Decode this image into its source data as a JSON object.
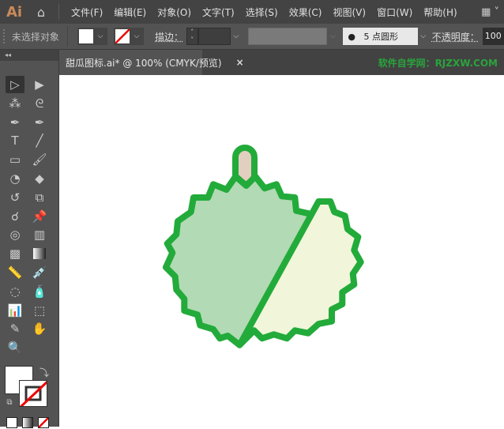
{
  "app": {
    "logo": "Ai",
    "home_icon": "home-icon",
    "workspace_icon": "workspace-switcher-icon"
  },
  "menu": [
    "文件(F)",
    "编辑(E)",
    "对象(O)",
    "文字(T)",
    "选择(S)",
    "效果(C)",
    "视图(V)",
    "窗口(W)",
    "帮助(H)"
  ],
  "control": {
    "selection": "未选择对象",
    "stroke_label": "描边：",
    "brush": "5 点圆形",
    "opacity_label": "不透明度：",
    "opacity": "100"
  },
  "document": {
    "tab": "甜瓜图标.ai* @ 100% (CMYK/预览)",
    "close": "×",
    "watermark": "软件自学网：RJZXW.COM"
  },
  "tools": [
    "selection",
    "direct-selection",
    "magic-wand",
    "lasso",
    "pen",
    "curvature",
    "type",
    "line-segment",
    "rectangle",
    "paintbrush",
    "shaper",
    "eraser",
    "rotate",
    "scale",
    "puppet-warp",
    "pin",
    "shape-builder",
    "perspective-grid",
    "mesh",
    "gradient",
    "measure",
    "eyedropper",
    "blend",
    "symbol-sprayer",
    "column-graph",
    "artboard",
    "slice",
    "hand",
    "zoom"
  ],
  "colors": {
    "outline": "#22ab3a",
    "left_fill": "#b2dab4",
    "right_fill": "#f1f5da",
    "stem_fill": "#e3cfc0"
  }
}
